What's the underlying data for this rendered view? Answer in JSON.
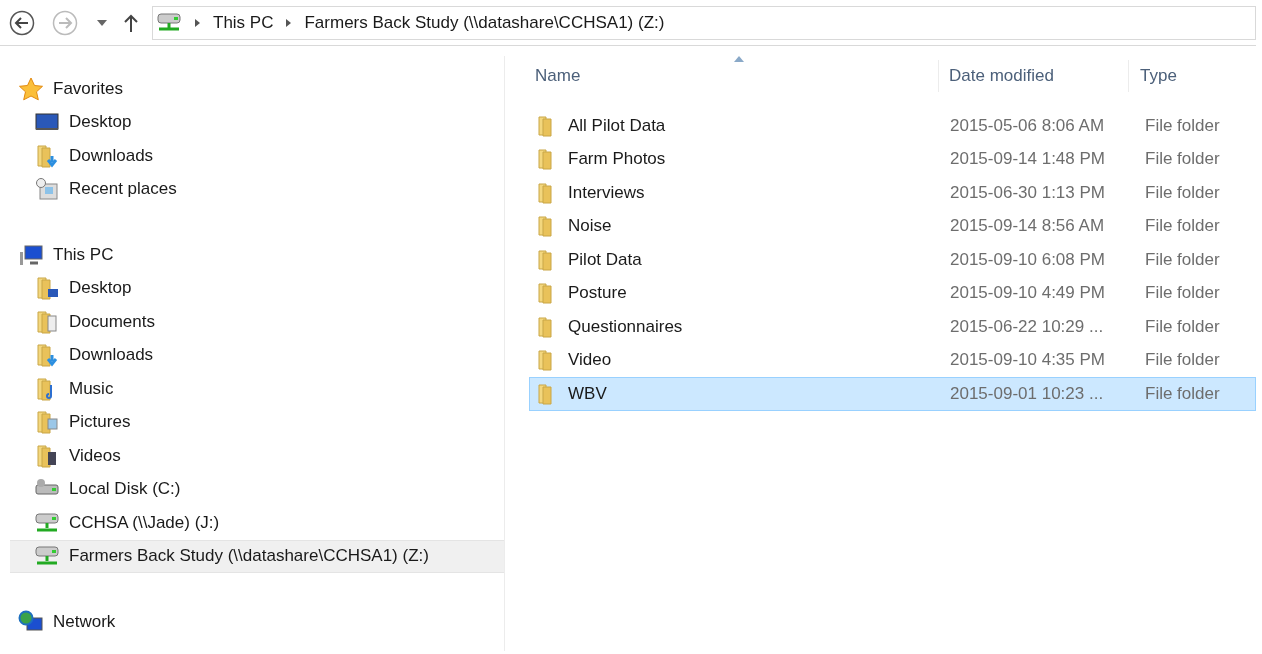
{
  "address_bar": {
    "crumbs": [
      "This PC",
      "Farmers Back Study (\\\\datashare\\CCHSA1) (Z:)"
    ]
  },
  "navigation_pane": {
    "sections": [
      {
        "label": "Favorites",
        "kind": "star",
        "selected": false,
        "children": [
          {
            "label": "Desktop",
            "kind": "desktop",
            "selected": false
          },
          {
            "label": "Downloads",
            "kind": "downloads",
            "selected": false
          },
          {
            "label": "Recent places",
            "kind": "recent",
            "selected": false
          }
        ]
      },
      {
        "label": "This PC",
        "kind": "pc",
        "selected": false,
        "children": [
          {
            "label": "Desktop",
            "kind": "desktop-folder",
            "selected": false
          },
          {
            "label": "Documents",
            "kind": "documents",
            "selected": false
          },
          {
            "label": "Downloads",
            "kind": "downloads",
            "selected": false
          },
          {
            "label": "Music",
            "kind": "music",
            "selected": false
          },
          {
            "label": "Pictures",
            "kind": "pictures",
            "selected": false
          },
          {
            "label": "Videos",
            "kind": "videos",
            "selected": false
          },
          {
            "label": "Local Disk (C:)",
            "kind": "disk",
            "selected": false
          },
          {
            "label": "CCHSA (\\\\Jade) (J:)",
            "kind": "network-drive",
            "selected": false
          },
          {
            "label": "Farmers Back Study (\\\\datashare\\CCHSA1) (Z:)",
            "kind": "network-drive",
            "selected": true
          }
        ]
      },
      {
        "label": "Network",
        "kind": "network",
        "selected": false
      }
    ]
  },
  "file_list": {
    "columns": [
      {
        "label": "Name",
        "sorted": true
      },
      {
        "label": "Date modified",
        "sorted": false
      },
      {
        "label": "Type",
        "sorted": false
      }
    ],
    "rows": [
      {
        "name": "All Pilot Data",
        "date": "2015-05-06 8:06 AM",
        "type": "File folder",
        "selected": false
      },
      {
        "name": "Farm Photos",
        "date": "2015-09-14 1:48 PM",
        "type": "File folder",
        "selected": false
      },
      {
        "name": "Interviews",
        "date": "2015-06-30 1:13 PM",
        "type": "File folder",
        "selected": false
      },
      {
        "name": "Noise",
        "date": "2015-09-14 8:56 AM",
        "type": "File folder",
        "selected": false
      },
      {
        "name": "Pilot Data",
        "date": "2015-09-10 6:08 PM",
        "type": "File folder",
        "selected": false
      },
      {
        "name": "Posture",
        "date": "2015-09-10 4:49 PM",
        "type": "File folder",
        "selected": false
      },
      {
        "name": "Questionnaires",
        "date": "2015-06-22 10:29 ...",
        "type": "File folder",
        "selected": false
      },
      {
        "name": "Video",
        "date": "2015-09-10 4:35 PM",
        "type": "File folder",
        "selected": false
      },
      {
        "name": "WBV",
        "date": "2015-09-01 10:23 ...",
        "type": "File folder",
        "selected": true
      }
    ]
  }
}
